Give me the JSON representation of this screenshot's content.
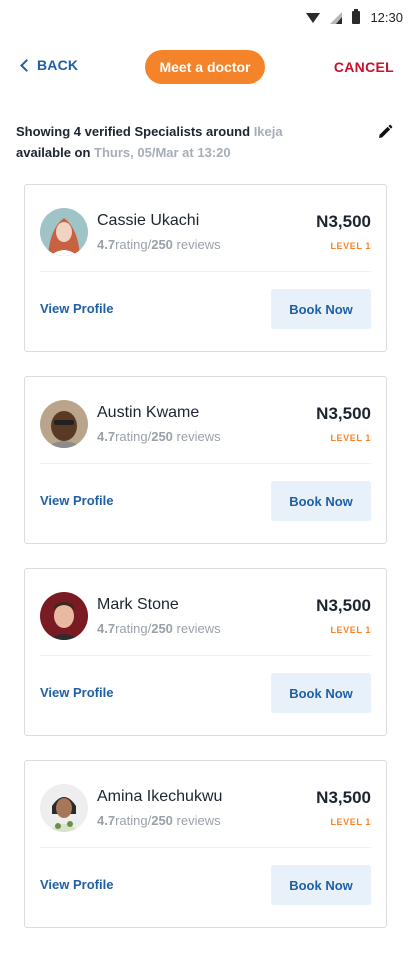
{
  "status_bar": {
    "time": "12:30"
  },
  "header": {
    "back_label": "BACK",
    "title": "Meet a doctor",
    "cancel_label": "CANCEL"
  },
  "summary": {
    "line1_prefix": "Showing 4 verified Specialists around",
    "location": "Ikeja",
    "line2_prefix": "available on",
    "datetime": "Thurs, 05/Mar at 13:20"
  },
  "doctors": [
    {
      "name": "Cassie Ukachi",
      "rating": "4.7",
      "rating_word": "rating/",
      "reviews": "250",
      "reviews_word": "reviews",
      "price": "N3,500",
      "level": "LEVEL 1",
      "view_label": "View Profile",
      "book_label": "Book Now"
    },
    {
      "name": "Austin Kwame",
      "rating": "4.7",
      "rating_word": "rating/",
      "reviews": "250",
      "reviews_word": "reviews",
      "price": "N3,500",
      "level": "LEVEL 1",
      "view_label": "View Profile",
      "book_label": "Book Now"
    },
    {
      "name": "Mark Stone",
      "rating": "4.7",
      "rating_word": "rating/",
      "reviews": "250",
      "reviews_word": "reviews",
      "price": "N3,500",
      "level": "LEVEL 1",
      "view_label": "View Profile",
      "book_label": "Book Now"
    },
    {
      "name": "Amina Ikechukwu",
      "rating": "4.7",
      "rating_word": "rating/",
      "reviews": "250",
      "reviews_word": "reviews",
      "price": "N3,500",
      "level": "LEVEL 1",
      "view_label": "View Profile",
      "book_label": "Book Now"
    }
  ],
  "colors": {
    "accent_orange": "#f5832a",
    "link_blue": "#1f5fa8",
    "cancel_red": "#c8102e",
    "book_button_bg": "#e8f1fa"
  }
}
